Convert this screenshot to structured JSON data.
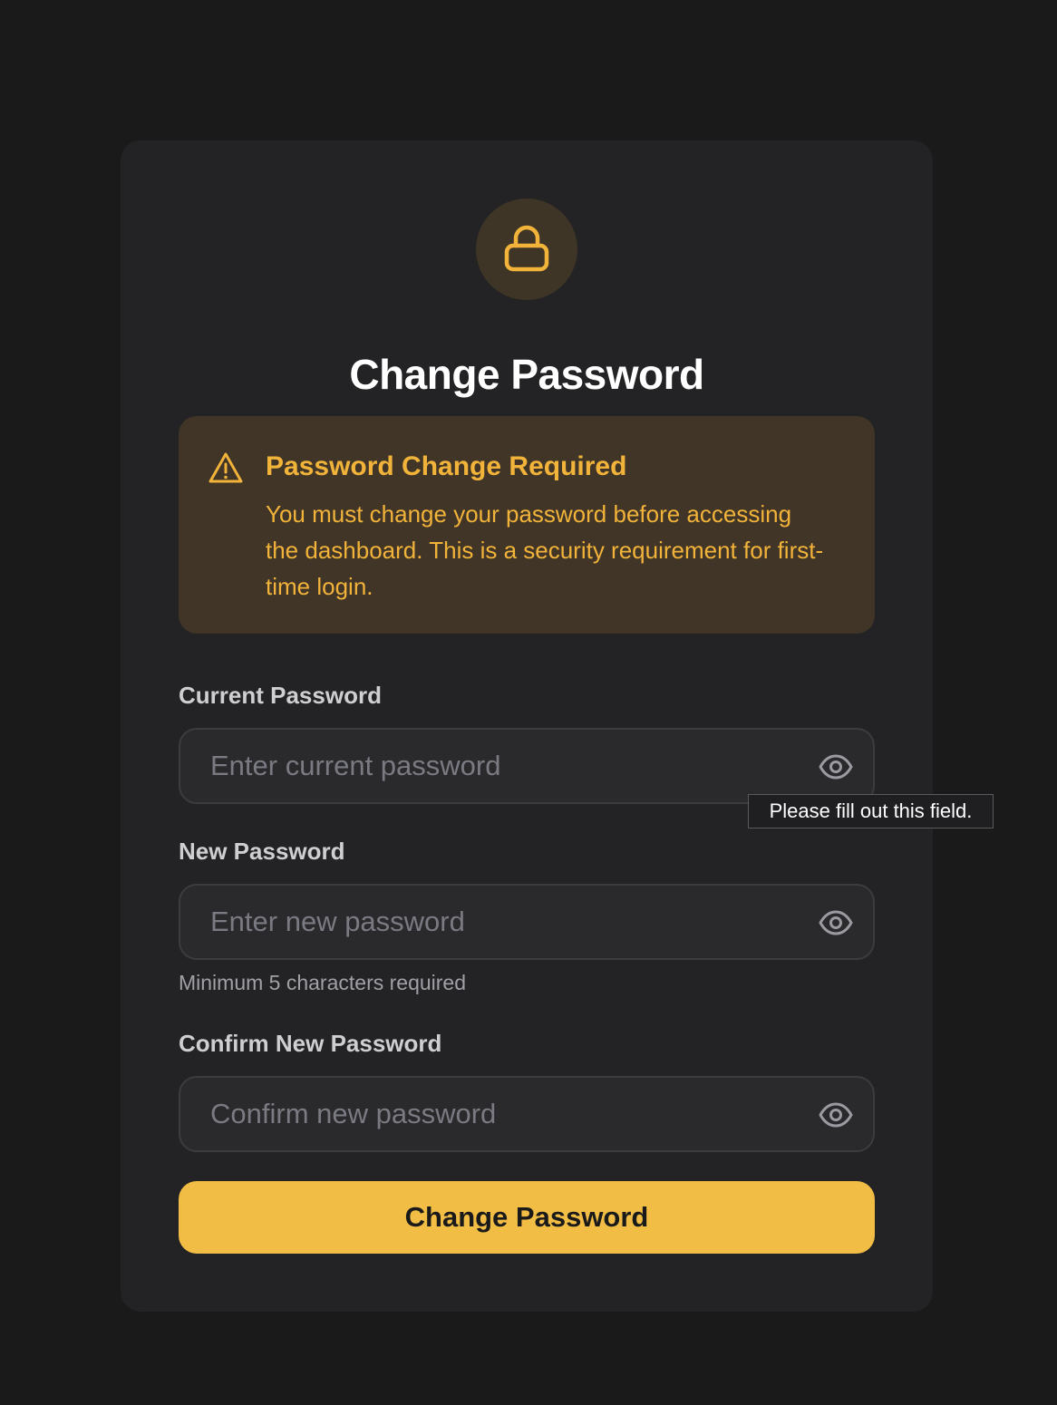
{
  "header": {
    "icon": "lock-icon",
    "title": "Change Password"
  },
  "alert": {
    "icon": "warning-triangle-icon",
    "title": "Password Change Required",
    "message": "You must change your password before accessing the dashboard. This is a security requirement for first-time login."
  },
  "form": {
    "current": {
      "label": "Current Password",
      "placeholder": "Enter current password",
      "value": ""
    },
    "new": {
      "label": "New Password",
      "placeholder": "Enter new password",
      "value": "",
      "hint": "Minimum 5 characters required"
    },
    "confirm": {
      "label": "Confirm New Password",
      "placeholder": "Confirm new password",
      "value": ""
    },
    "toggle_icon": "eye-icon",
    "submit_label": "Change Password"
  },
  "tooltip": {
    "text": "Please fill out this field."
  },
  "colors": {
    "background": "#1a1a1b",
    "card": "#232325",
    "accent": "#f2bd45",
    "warning_text": "#f2b33b",
    "warning_bg": "#403526"
  }
}
